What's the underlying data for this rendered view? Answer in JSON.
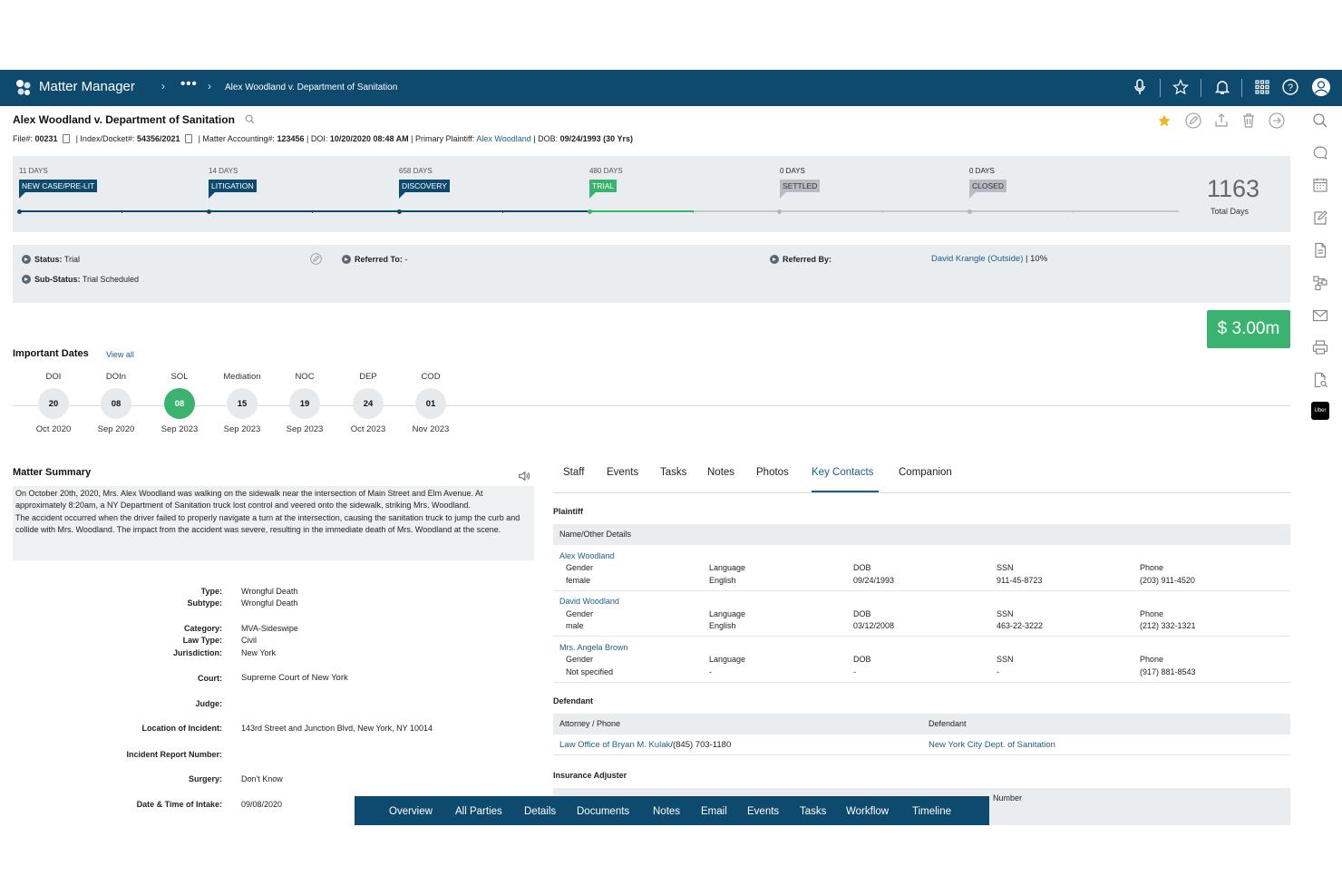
{
  "app": {
    "name": "Matter Manager",
    "more": "•••",
    "breadcrumb": "Alex Woodland v. Department of Sanitation"
  },
  "header": {
    "title": "Alex Woodland v. Department of Sanitation",
    "file_label": "File#:",
    "file_no": "00231",
    "index_label": "| Index/Docket#:",
    "index_no": "54356/2021",
    "accounting_label": "| Matter Accounting#:",
    "accounting_no": "123456",
    "doi_label": "| DOI:",
    "doi": "10/20/2020 08:48 AM",
    "plaintiff_label": "| Primary Plaintiff:",
    "plaintiff": "Alex Woodland",
    "dob_label": "| DOB:",
    "dob": "09/24/1993 (30 Yrs)"
  },
  "stages": [
    {
      "days": "11 DAYS",
      "name": "NEW CASE/PRE-LIT",
      "state": "done"
    },
    {
      "days": "14 DAYS",
      "name": "LITIGATION",
      "state": "done"
    },
    {
      "days": "658 DAYS",
      "name": "DISCOVERY",
      "state": "done"
    },
    {
      "days": "480 DAYS",
      "name": "TRIAL",
      "state": "current"
    },
    {
      "days": "0 DAYS",
      "name": "SETTLED",
      "state": "pending"
    },
    {
      "days": "0 DAYS",
      "name": "CLOSED",
      "state": "pending"
    }
  ],
  "total": {
    "days": "1163",
    "label": "Total Days"
  },
  "status": {
    "status_label": "Status:",
    "status": "Trial",
    "substatus_label": "Sub-Status:",
    "substatus": "Trial Scheduled",
    "referred_to_label": "Referred To:",
    "referred_to": "-",
    "referred_by_label": "Referred By:",
    "referred_by": "David Krangle (Outside)",
    "referred_pct": "| 10%"
  },
  "amount": "$ 3.00m",
  "important_dates": {
    "title": "Important Dates",
    "view_all": "View all",
    "items": [
      {
        "label": "DOI",
        "day": "20",
        "date": "Oct 2020",
        "active": false
      },
      {
        "label": "DOIn",
        "day": "08",
        "date": "Sep 2020",
        "active": false
      },
      {
        "label": "SOL",
        "day": "08",
        "date": "Sep 2023",
        "active": true
      },
      {
        "label": "Mediation",
        "day": "15",
        "date": "Sep 2023",
        "active": false
      },
      {
        "label": "NOC",
        "day": "19",
        "date": "Sep 2023",
        "active": false
      },
      {
        "label": "DEP",
        "day": "24",
        "date": "Oct 2023",
        "active": false
      },
      {
        "label": "COD",
        "day": "01",
        "date": "Nov 2023",
        "active": false
      }
    ]
  },
  "summary": {
    "title": "Matter Summary",
    "text1": "On October 20th, 2020, Mrs. Alex Woodland was walking on the sidewalk near the intersection of Main Street and Elm Avenue. At approximately 8:20am, a NY Department of Sanitation truck lost control and veered onto the sidewalk, striking Mrs. Woodland.",
    "text2": "The accident occurred when the driver failed to properly navigate a turn at the intersection, causing the sanitation truck to jump the curb and collide with Mrs. Woodland. The impact from the accident was severe, resulting in the immediate death of Mrs. Woodland at the scene."
  },
  "details": [
    {
      "label": "Type:",
      "value": "Wrongful Death",
      "link": false
    },
    {
      "label": "Subtype:",
      "value": "Wrongful Death",
      "link": false
    },
    {
      "label": "Category:",
      "value": "MVA-Sideswipe",
      "link": false
    },
    {
      "label": "Law Type:",
      "value": "Civil",
      "link": false
    },
    {
      "label": "Jurisdiction:",
      "value": "New York",
      "link": false
    },
    {
      "label": "Court:",
      "value": "Supreme Court of New York",
      "link": true
    },
    {
      "label": "Judge:",
      "value": "",
      "link": false
    },
    {
      "label": "Location of Incident:",
      "value": "143rd Street and Junction Blvd, New York, NY 10014",
      "link": false
    },
    {
      "label": "Incident Report Number:",
      "value": "",
      "link": false
    },
    {
      "label": "Surgery:",
      "value": "Don't Know",
      "link": false
    },
    {
      "label": "Date & Time of Intake:",
      "value": "09/08/2020",
      "link": false
    }
  ],
  "tabs": [
    "Staff",
    "Events",
    "Tasks",
    "Notes",
    "Photos",
    "Key Contacts",
    "Companion"
  ],
  "active_tab": "Key Contacts",
  "contacts": {
    "plaintiff_head": "Plaintiff",
    "name_header": "Name/Other Details",
    "plaintiffs": [
      {
        "name": "Alex Woodland",
        "gender_l": "Gender",
        "gender": "female",
        "lang_l": "Language",
        "lang": "English",
        "dob_l": "DOB",
        "dob": "09/24/1993",
        "ssn_l": "SSN",
        "ssn": "911-45-8723",
        "phone_l": "Phone",
        "phone": "(203) 911-4520"
      },
      {
        "name": "David Woodland",
        "gender_l": "Gender",
        "gender": "male",
        "lang_l": "Language",
        "lang": "English",
        "dob_l": "DOB",
        "dob": "03/12/2008",
        "ssn_l": "SSN",
        "ssn": "463-22-3222",
        "phone_l": "Phone",
        "phone": "(212) 332-1321"
      },
      {
        "name": "Mrs. Angela Brown",
        "gender_l": "Gender",
        "gender": "Not specified",
        "lang_l": "Language",
        "lang": "-",
        "dob_l": "DOB",
        "dob": "-",
        "ssn_l": "SSN",
        "ssn": "-",
        "phone_l": "Phone",
        "phone": "(917) 881-8543"
      }
    ],
    "defendant_head": "Defendant",
    "attorney_header": "Attorney / Phone",
    "defendant_header": "Defendant",
    "attorney": "Law Office of Bryan M. Kulak",
    "attorney_phone": "/(845) 703-1180",
    "defendant": "New York City Dept. of Sanitation",
    "insurance_head": "Insurance Adjuster",
    "insurance_partial": "Number"
  },
  "bottom_nav": [
    "Overview",
    "All Parties",
    "Details",
    "Documents",
    "Notes",
    "Email",
    "Events",
    "Tasks",
    "Workflow",
    "Timeline"
  ],
  "sidebar_badge": "Uber",
  "colors": {
    "primary": "#0e4a6e",
    "accent_green": "#3ab36e",
    "link": "#1a5d8a",
    "panel": "#e9edf0"
  }
}
